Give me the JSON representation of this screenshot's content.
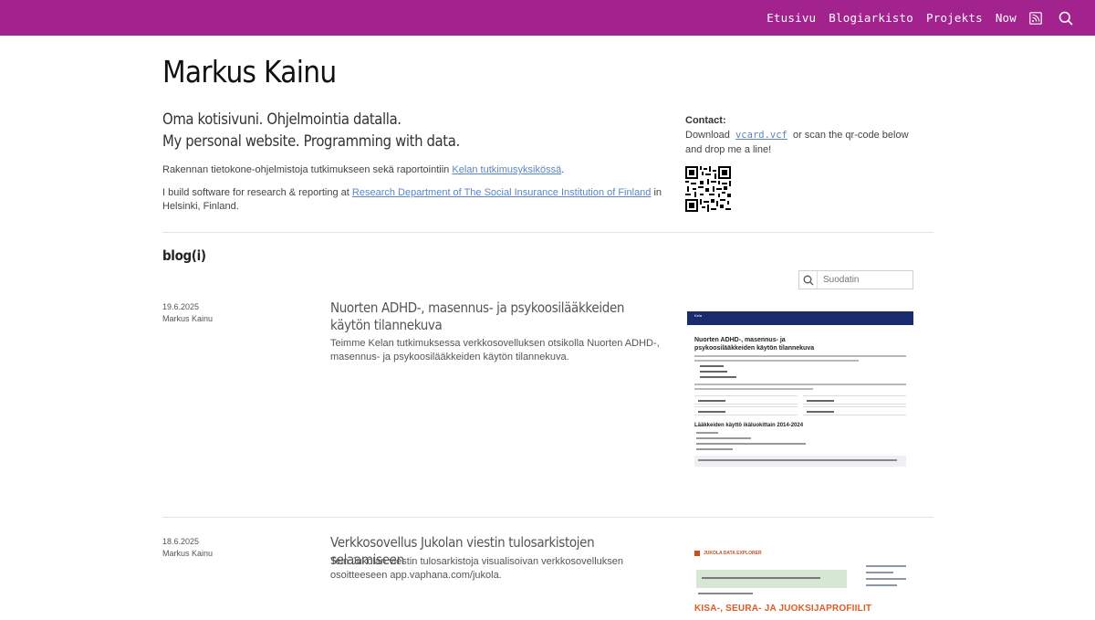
{
  "nav": {
    "items": [
      "Etusivu",
      "Blogiarkisto",
      "Projekts",
      "Now"
    ],
    "rss_icon": "rss-icon",
    "search_icon": "search-icon"
  },
  "site": {
    "title": "Markus Kainu",
    "tagline_fi": "Oma kotisivuni. Ohjelmointia datalla.",
    "tagline_en": "My personal website. Programming with data.",
    "intro_fi_prefix": "Rakennan tietokone-ohjelmistoja tutkimukseen sekä raportointiin",
    "intro_fi_link": "Kelan tutkimusyksikössä",
    "intro_fi_suffix": ".",
    "intro_en_prefix": "I build software for research & reporting at",
    "intro_en_link": "Research Department of The Social Insurance Institution of Finland",
    "intro_en_suffix": "in Helsinki, Finland."
  },
  "contact": {
    "heading": "Contact:",
    "download_label": "Download",
    "vcard_file": "vcard.vcf",
    "rest": "or scan the qr-code below and drop me a line!"
  },
  "blog": {
    "heading": "blog(i)",
    "filter_placeholder": "Suodatin",
    "posts": [
      {
        "date": "19.6.2025",
        "author": "Markus Kainu",
        "title": "Nuorten ADHD-, masennus- ja psykoosilääkkeiden käytön tilannekuva",
        "summary": "Teimme Kelan tutkimuksessa verkkosovelluksen otsikolla Nuorten ADHD-, masennus- ja psykoosilääkkeiden käytön tilannekuva.",
        "thumb": {
          "org": "Kela",
          "heading": "Nuorten ADHD-, masennus- ja psykoosilääkkeiden käytön tilannekuva",
          "subheading": "Lääkkeiden käyttö ikäluokittain 2014-2024"
        }
      },
      {
        "date": "18.6.2025",
        "author": "Markus Kainu",
        "title": "Verkkosovellus Jukolan viestin tulosarkistojen selaamiseen",
        "summary": "Tein Jukolan viestin tulosarkistoja visualisoivan verkkosovelluksen osoitteeseen app.vaphana.com/jukola.",
        "thumb": {
          "header": "JUKOLA DATA EXPLORER",
          "big_text": "KISA-, SEURA- JA JUOKSIJAPROFIILIT"
        }
      }
    ]
  },
  "colors": {
    "topbar": "#a3238e",
    "link": "#5a86c5",
    "kela_bar": "#1a2b6d",
    "jukola_accent": "#e05a24"
  }
}
